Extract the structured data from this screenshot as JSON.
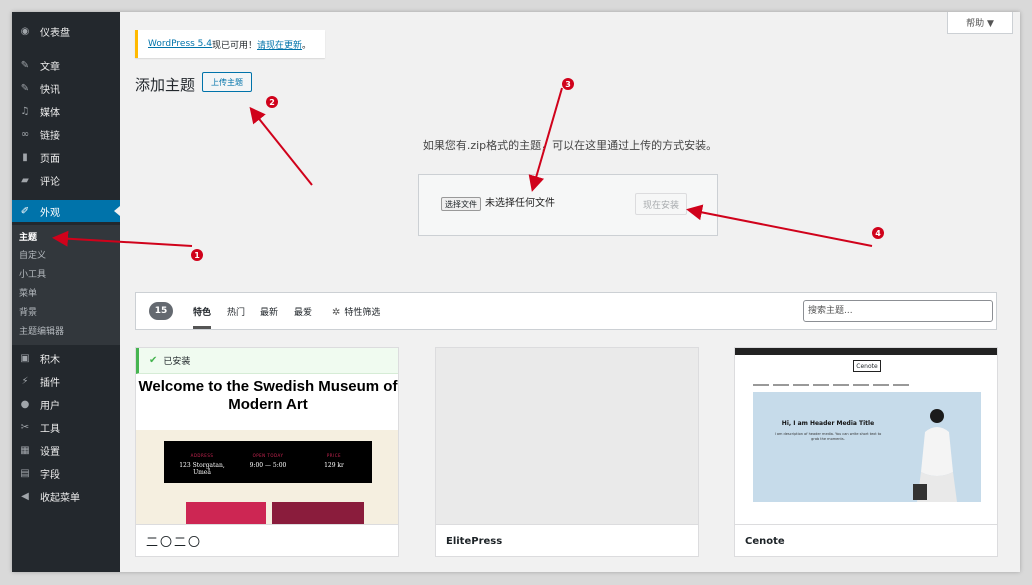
{
  "sidebar": {
    "items": [
      {
        "label": "仪表盘",
        "icon": "dashboard-icon"
      },
      {
        "label": "文章",
        "icon": "pin-icon"
      },
      {
        "label": "快讯",
        "icon": "pin-icon"
      },
      {
        "label": "媒体",
        "icon": "media-icon"
      },
      {
        "label": "链接",
        "icon": "link-icon"
      },
      {
        "label": "页面",
        "icon": "page-icon"
      },
      {
        "label": "评论",
        "icon": "comment-icon"
      },
      {
        "label": "外观",
        "icon": "appearance-icon"
      },
      {
        "label": "积木",
        "icon": "blocks-icon"
      },
      {
        "label": "插件",
        "icon": "plugin-icon"
      },
      {
        "label": "用户",
        "icon": "user-icon"
      },
      {
        "label": "工具",
        "icon": "tools-icon"
      },
      {
        "label": "设置",
        "icon": "settings-icon"
      },
      {
        "label": "字段",
        "icon": "fields-icon"
      },
      {
        "label": "收起菜单",
        "icon": "collapse-icon"
      }
    ],
    "submenu": [
      "主题",
      "自定义",
      "小工具",
      "菜单",
      "背景",
      "主题编辑器"
    ]
  },
  "help_label": "帮助 ▼",
  "notice": {
    "link1": "WordPress 5.4",
    "mid": "现已可用！",
    "link2": "请现在更新",
    "end": "。"
  },
  "page_title": "添加主题",
  "upload_button": "上传主题",
  "upload_desc": "如果您有.zip格式的主题，可以在这里通过上传的方式安装。",
  "choose_file": "选择文件",
  "no_file": "未选择任何文件",
  "install_now": "现在安装",
  "filter": {
    "count": "15",
    "tabs": [
      "特色",
      "热门",
      "最新",
      "最爱"
    ],
    "feature_filter": "特性筛选",
    "search_placeholder": "搜索主题..."
  },
  "themes": [
    {
      "name": "二〇二〇",
      "installed": "已安装",
      "preview_heading": "Welcome to the Swedish Museum of Modern Art",
      "band": [
        {
          "label": "ADDRESS",
          "value": "123 Storgatan, Umeå"
        },
        {
          "label": "OPEN TODAY",
          "value": "9:00 — 5:00"
        },
        {
          "label": "PRICE",
          "value": "129 kr"
        }
      ]
    },
    {
      "name": "ElitePress"
    },
    {
      "name": "Cenote",
      "logo": "Cenote",
      "hero_title": "Hi, I am Header Media Title",
      "hero_sub": "I am description of header media. You can write short text to grab the moments."
    }
  ],
  "annotations": [
    "1",
    "2",
    "3",
    "4"
  ],
  "colors": {
    "accent": "#0073aa",
    "sidebar": "#23282d",
    "arrow": "#d0021b",
    "installed": "#46b450"
  }
}
